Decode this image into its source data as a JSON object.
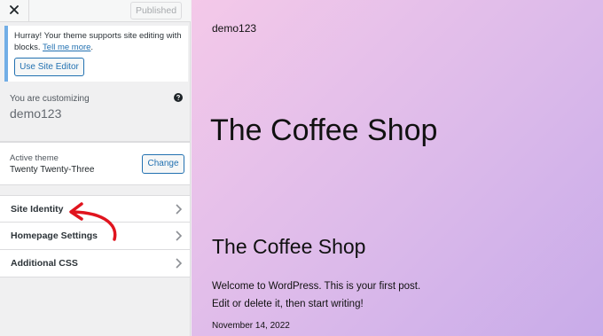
{
  "topbar": {
    "close_icon": "close-icon",
    "publish_label": "Published"
  },
  "notice": {
    "text": "Hurray! Your theme supports site editing with blocks.",
    "link_text": "Tell me more",
    "link_suffix": ".",
    "button_label": "Use Site Editor",
    "accent_color": "#72aee6"
  },
  "customizing": {
    "label": "You are customizing",
    "site_name": "demo123",
    "help_icon": "question-circle-icon"
  },
  "theme": {
    "label": "Active theme",
    "name": "Twenty Twenty-Three",
    "change_label": "Change"
  },
  "menu": {
    "items": [
      {
        "label": "Site Identity",
        "icon": "chevron-right-icon"
      },
      {
        "label": "Homepage Settings",
        "icon": "chevron-right-icon"
      },
      {
        "label": "Additional CSS",
        "icon": "chevron-right-icon"
      }
    ]
  },
  "annotation": {
    "icon": "red-arrow-icon",
    "color": "#e0141e"
  },
  "preview": {
    "tagline": "demo123",
    "site_title": "The Coffee Shop",
    "post_title": "The Coffee Shop",
    "post_body_line1": "Welcome to WordPress. This is your first post.",
    "post_body_line2": "Edit or delete it, then start writing!",
    "post_date": "November 14, 2022",
    "gradient_colors": [
      "#f4c9e9",
      "#c8abe9"
    ]
  }
}
